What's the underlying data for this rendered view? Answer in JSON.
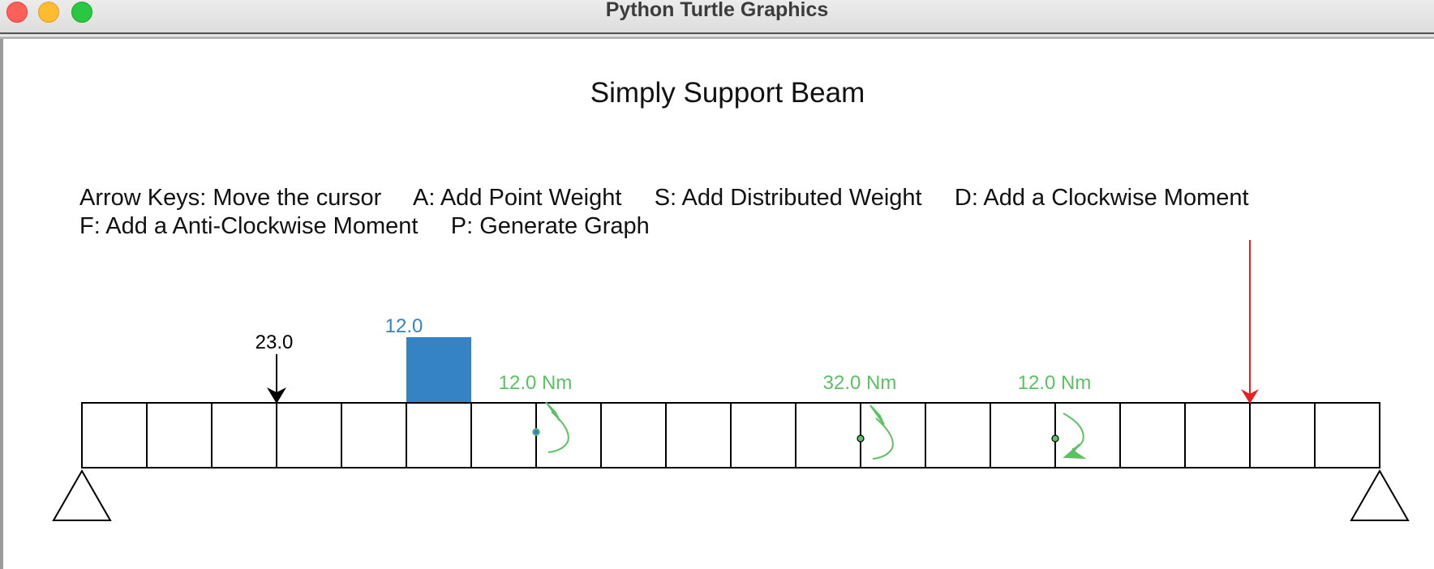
{
  "window": {
    "title": "Python Turtle Graphics",
    "controls": [
      "close",
      "minimize",
      "maximize"
    ]
  },
  "canvas": {
    "heading": "Simply Support Beam",
    "instructions": {
      "row1": [
        "Arrow Keys: Move the cursor",
        "A: Add Point Weight",
        "S: Add Distributed Weight",
        "D: Add a Clockwise Moment"
      ],
      "row2": [
        "F: Add a Anti-Clockwise Moment",
        "P: Generate Graph"
      ]
    }
  },
  "beam": {
    "segment_count": 20,
    "supports": [
      "left-support",
      "right-support"
    ]
  },
  "loads": {
    "point_weight": {
      "label": "23.0",
      "color": "#000000"
    },
    "distributed_weight": {
      "label": "12.0",
      "color": "#3582c4"
    },
    "moments": [
      {
        "label": "12.0 Nm",
        "direction": "anti-clockwise",
        "color": "#5bc264"
      },
      {
        "label": "32.0 Nm",
        "direction": "anti-clockwise",
        "color": "#5bc264"
      },
      {
        "label": "12.0 Nm",
        "direction": "clockwise",
        "color": "#5bc264"
      }
    ],
    "cursor": {
      "color": "#e52020"
    }
  }
}
